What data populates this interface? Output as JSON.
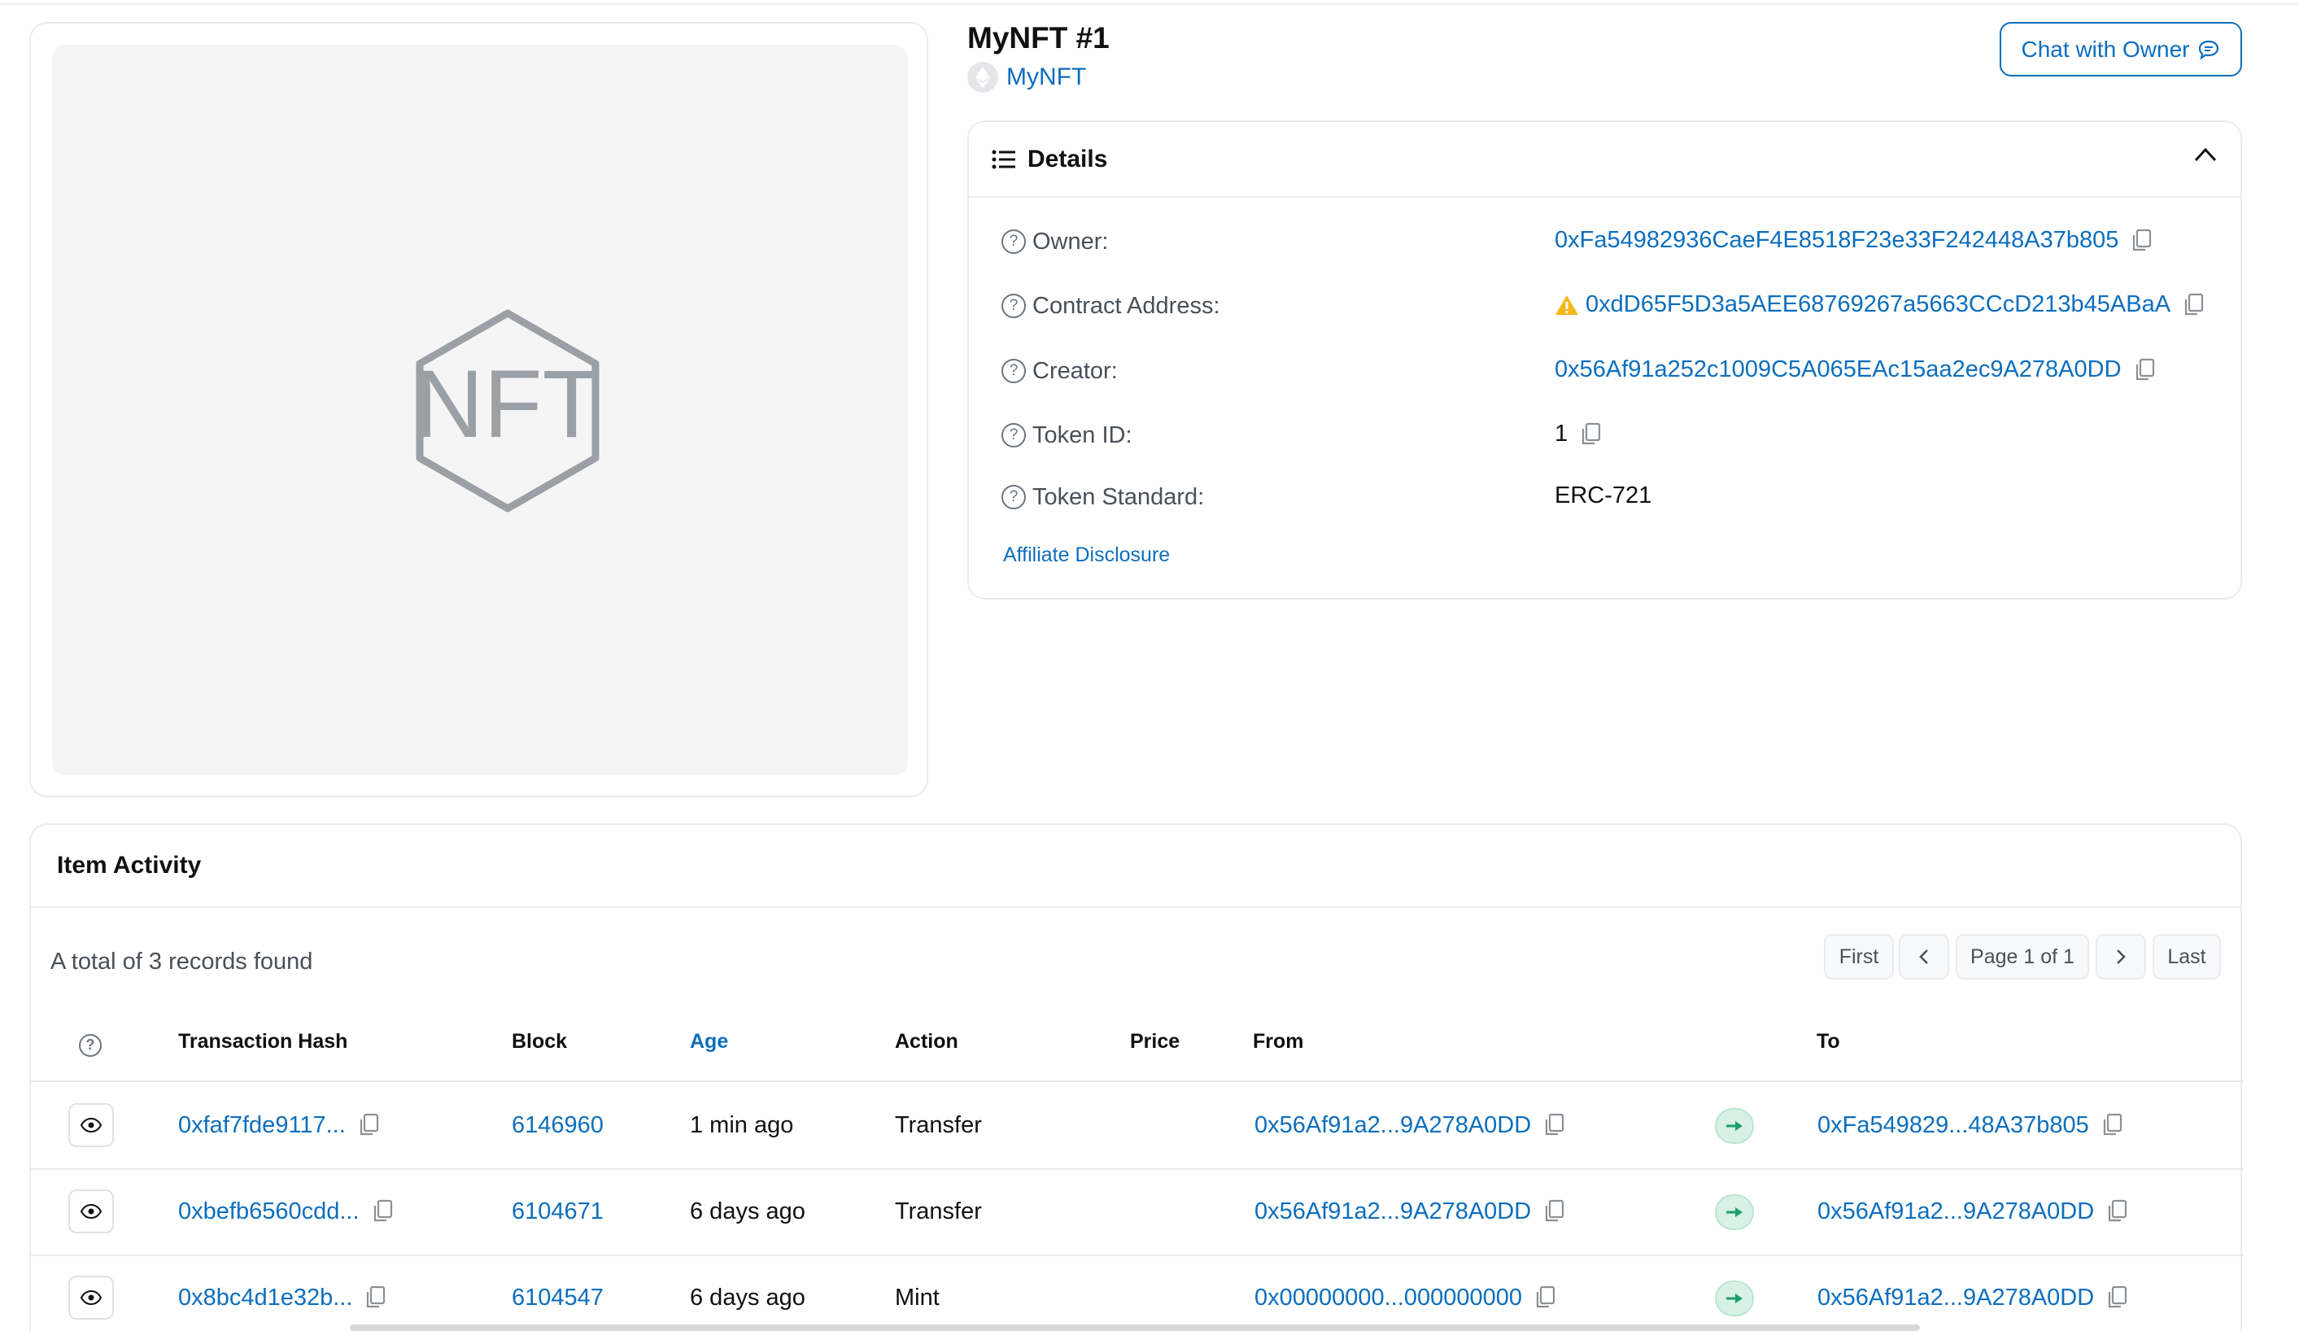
{
  "nft": {
    "title": "MyNFT #1",
    "collection": "MyNFT",
    "image_placeholder": "NFT",
    "chat_button": "Chat with Owner"
  },
  "details": {
    "title": "Details",
    "rows": [
      {
        "label": "Owner:",
        "value": "0xFa54982936CaeF4E8518F23e33F242448A37b805"
      },
      {
        "label": "Contract Address:",
        "value": "0xdD65F5D3a5AEE68769267a5663CCcD213b45ABaA"
      },
      {
        "label": "Creator:",
        "value": "0x56Af91a252c1009C5A065EAc15aa2ec9A278A0DD"
      },
      {
        "label": "Token ID:",
        "value": "1"
      },
      {
        "label": "Token Standard:",
        "value": "ERC-721"
      }
    ],
    "affiliate": "Affiliate Disclosure"
  },
  "activity": {
    "title": "Item Activity",
    "records": "A total of 3 records found",
    "pager": {
      "first": "First",
      "page": "Page 1 of 1",
      "last": "Last"
    },
    "columns": {
      "hash": "Transaction Hash",
      "block": "Block",
      "age": "Age",
      "action": "Action",
      "price": "Price",
      "from": "From",
      "to": "To"
    },
    "rows": [
      {
        "hash": "0xfaf7fde9117...",
        "block": "6146960",
        "age": "1 min ago",
        "action": "Transfer",
        "price": "",
        "from": "0x56Af91a2...9A278A0DD",
        "to": "0xFa549829...48A37b805"
      },
      {
        "hash": "0xbefb6560cdd...",
        "block": "6104671",
        "age": "6 days ago",
        "action": "Transfer",
        "price": "",
        "from": "0x56Af91a2...9A278A0DD",
        "to": "0x56Af91a2...9A278A0DD"
      },
      {
        "hash": "0x8bc4d1e32b...",
        "block": "6104547",
        "age": "6 days ago",
        "action": "Mint",
        "price": "",
        "from": "0x00000000...000000000",
        "to": "0x56Af91a2...9A278A0DD"
      }
    ]
  },
  "colors": {
    "link": "#0d6ebd",
    "warning": "#f4b619",
    "arrow_bg": "#d8f1e6",
    "arrow": "#1c9e6a"
  },
  "icons": [
    "eth-icon",
    "chat-icon",
    "list-icon",
    "chevron-up-icon",
    "help-circle-icon",
    "copy-icon",
    "warning-icon",
    "eye-icon",
    "arrow-right-icon",
    "chevron-left-icon",
    "chevron-right-icon"
  ]
}
